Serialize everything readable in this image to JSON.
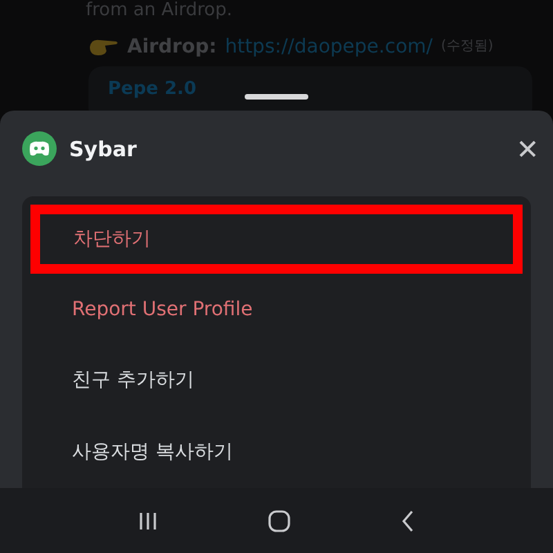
{
  "chat": {
    "message_tail": "from an Airdrop.",
    "airdrop_label": "Airdrop:",
    "airdrop_link": "https://daopepe.com/",
    "edited_tag": "(수정됨)",
    "embed_title": "Pepe 2.0"
  },
  "sheet": {
    "username": "Sybar",
    "close": "✕",
    "items": [
      {
        "label": "차단하기",
        "kind": "danger",
        "highlighted": true
      },
      {
        "label": "Report User Profile",
        "kind": "danger",
        "highlighted": false
      },
      {
        "label": "친구 추가하기",
        "kind": "normal",
        "highlighted": false
      },
      {
        "label": "사용자명 복사하기",
        "kind": "normal",
        "highlighted": false
      }
    ]
  }
}
